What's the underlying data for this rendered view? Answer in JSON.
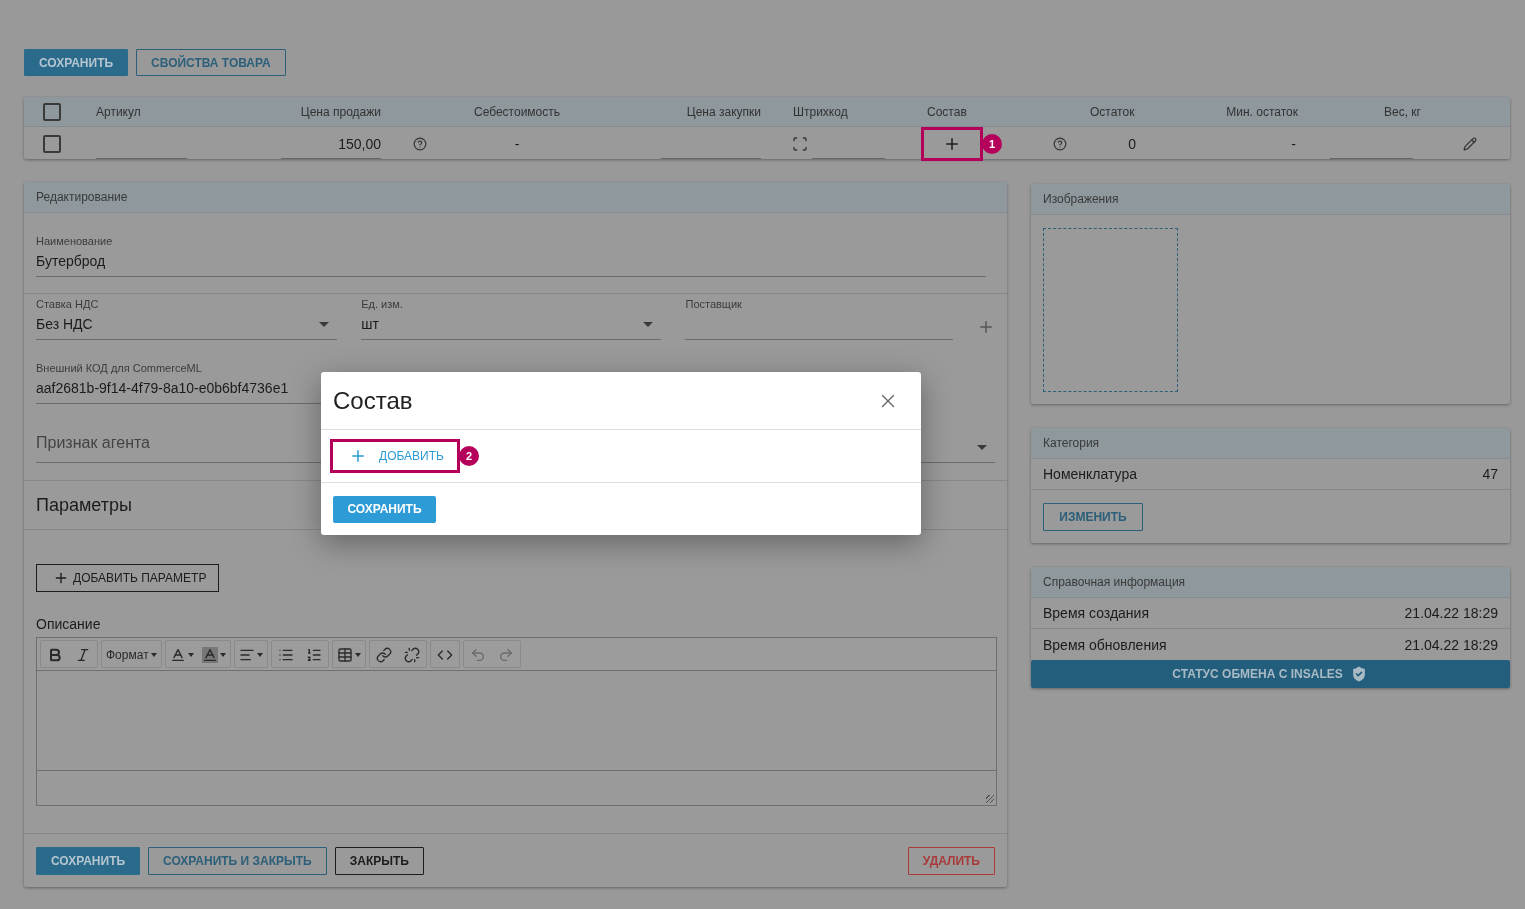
{
  "toolbar": {
    "buttons": [
      {
        "label": "СОХРАНИТЬ",
        "kind": "primary"
      },
      {
        "label": "СВОЙСТВА ТОВАРА",
        "kind": "outline"
      }
    ]
  },
  "table": {
    "header_checked": false,
    "columns": [
      "Артикул",
      "Цена продажи",
      "Себестоимость",
      "Цена закупки",
      "Штрихкод",
      "Состав",
      "Остаток",
      "Мин. остаток",
      "Вес, кг"
    ],
    "row": {
      "checked": false,
      "price": "150,00",
      "cost": "-",
      "composition_marker": "1",
      "stock": "0",
      "min_stock": "-"
    }
  },
  "editing": {
    "title": "Редактирование",
    "name": {
      "label": "Наименование",
      "value": "Бутерброд"
    },
    "vat": {
      "label": "Ставка НДС",
      "value": "Без НДС"
    },
    "unit": {
      "label": "Ед. изм.",
      "value": "шт"
    },
    "supplier": {
      "label": "Поставщик"
    },
    "external_code": {
      "label": "Внешний КОД для CommerceML",
      "value": "aaf2681b-9f14-4f79-8a10-e0b6bf4736e1"
    },
    "agent": {
      "placeholder": "Признак агента"
    },
    "params_title": "Параметры",
    "add_param": "ДОБАВИТЬ ПАРАМЕТР",
    "description_label": "Описание",
    "format_label": "Формат",
    "footer": [
      {
        "label": "СОХРАНИТЬ",
        "kind": "primary"
      },
      {
        "label": "СОХРАНИТЬ И ЗАКРЫТЬ",
        "kind": "outline"
      },
      {
        "label": "ЗАКРЫТЬ",
        "kind": "dark"
      },
      {
        "label": "УДАЛИТЬ",
        "kind": "danger"
      }
    ]
  },
  "images": {
    "title": "Изображения"
  },
  "category": {
    "title": "Категория",
    "name": "Номенклатура",
    "count": "47",
    "button": "ИЗМЕНИТЬ"
  },
  "info": {
    "title": "Справочная информация",
    "rows": [
      {
        "label": "Время создания",
        "value": "21.04.22 18:29"
      },
      {
        "label": "Время обновления",
        "value": "21.04.22 18:29"
      }
    ],
    "status_button": "СТАТУС ОБМЕНА С INSALES"
  },
  "modal": {
    "title": "Состав",
    "add_label": "ДОБАВИТЬ",
    "marker": "2",
    "save_label": "СОХРАНИТЬ"
  }
}
